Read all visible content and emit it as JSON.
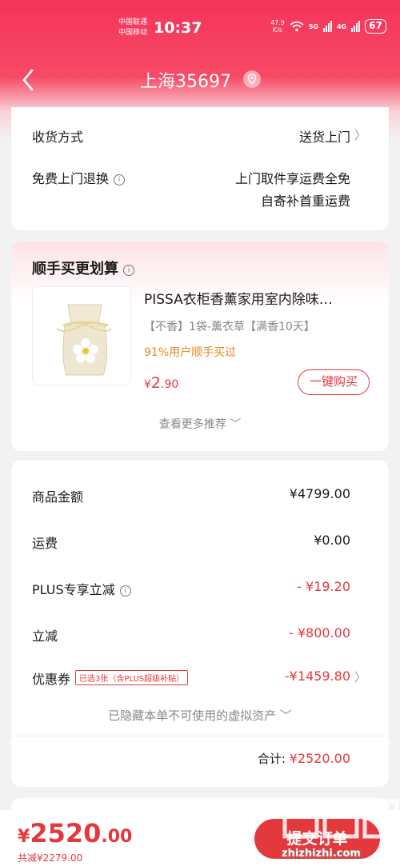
{
  "status_bar": {
    "carrier_1": "中国联通",
    "carrier_2": "中国移动",
    "time": "10:37",
    "net_speed_value": "47.9",
    "net_speed_unit": "K/s",
    "sig1_label": "5G",
    "sig2_label": "4G",
    "battery": "67"
  },
  "nav": {
    "title": "上海35697"
  },
  "delivery": {
    "method_label": "收货方式",
    "method_value": "送货上门",
    "return_label": "免费上门退换",
    "return_value_1": "上门取件享运费全免",
    "return_value_2": "自寄补首重运费"
  },
  "addon": {
    "title": "顺手买更划算",
    "product_title": "PISSA衣柜香薰家用室内除味…",
    "product_spec": "【不香】1袋-薰衣草【满香10天】",
    "product_stat": "91%用户顺手买过",
    "price_symbol": "¥",
    "price_int": "2",
    "price_dec": ".90",
    "buy_label": "一键购买",
    "more_label": "查看更多推荐"
  },
  "summary": {
    "rows": [
      {
        "label": "商品金额",
        "value": "¥4799.00"
      },
      {
        "label": "运费",
        "value": "¥0.00"
      },
      {
        "label": "PLUS专享立减",
        "value": "- ¥19.20"
      },
      {
        "label": "立减",
        "value": "- ¥800.00"
      },
      {
        "label": "优惠券",
        "value": "-¥1459.80"
      }
    ],
    "coupon_tag": "已选3张（含PLUS超级补贴）",
    "hidden_assets": "已隐藏本单不可使用的虚拟资产",
    "total_label": "合计:",
    "total_value": "¥2520.00"
  },
  "footer": {
    "price_symbol": "¥",
    "price_int": "2520",
    "price_dec": ".00",
    "saved": "共减¥2279.00",
    "submit_label": "提交订单"
  },
  "watermark": {
    "text": "zhizhizhi.com"
  },
  "colors": {
    "accent": "#e4393c",
    "header": "#f5335a",
    "orange": "#e08a1f"
  }
}
